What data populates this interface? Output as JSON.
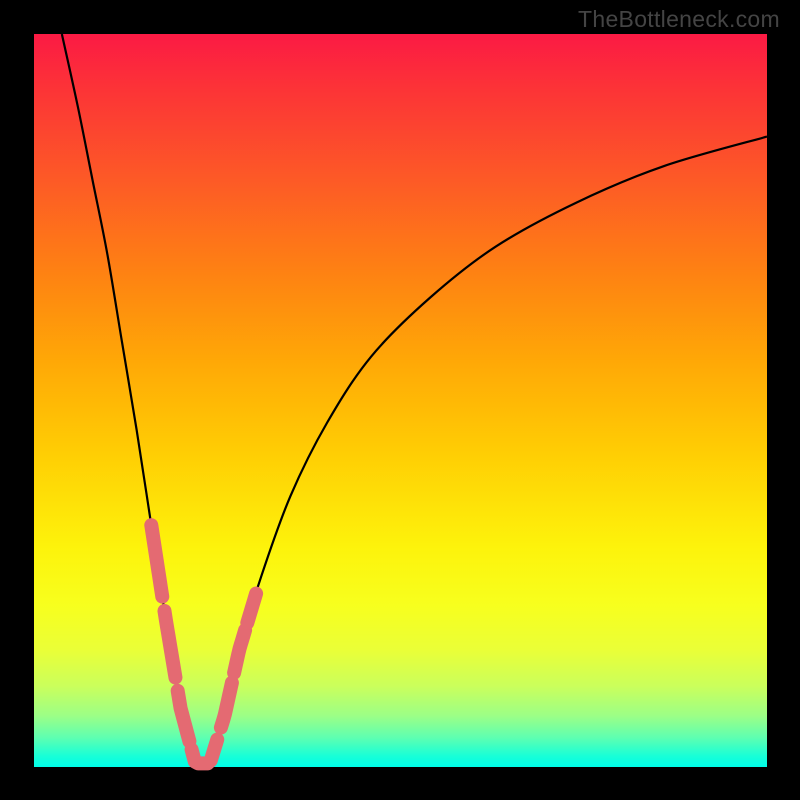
{
  "watermark": "TheBottleneck.com",
  "chart_data": {
    "type": "line",
    "title": "",
    "xlabel": "",
    "ylabel": "",
    "xlim": [
      0,
      100
    ],
    "ylim": [
      0,
      100
    ],
    "grid": false,
    "legend": false,
    "curve_note": "V-shaped performance curve; minimum near x≈22, left arm steep, right arm asymptoting upward",
    "points": [
      {
        "x": 3.8,
        "y": 100
      },
      {
        "x": 6,
        "y": 90
      },
      {
        "x": 8,
        "y": 80
      },
      {
        "x": 10,
        "y": 70
      },
      {
        "x": 12,
        "y": 58
      },
      {
        "x": 14,
        "y": 46
      },
      {
        "x": 16,
        "y": 33
      },
      {
        "x": 18,
        "y": 20
      },
      {
        "x": 20,
        "y": 8
      },
      {
        "x": 22,
        "y": 0.5
      },
      {
        "x": 24,
        "y": 0.5
      },
      {
        "x": 26,
        "y": 7
      },
      {
        "x": 28,
        "y": 16
      },
      {
        "x": 31,
        "y": 26
      },
      {
        "x": 35,
        "y": 37
      },
      {
        "x": 40,
        "y": 47
      },
      {
        "x": 46,
        "y": 56
      },
      {
        "x": 54,
        "y": 64
      },
      {
        "x": 63,
        "y": 71
      },
      {
        "x": 74,
        "y": 77
      },
      {
        "x": 86,
        "y": 82
      },
      {
        "x": 100,
        "y": 86
      }
    ],
    "highlight_segments": [
      {
        "from": 16.0,
        "to": 17.5
      },
      {
        "from": 17.8,
        "to": 19.3
      },
      {
        "from": 19.6,
        "to": 21.2
      },
      {
        "from": 21.5,
        "to": 25.0
      },
      {
        "from": 25.5,
        "to": 27.0
      },
      {
        "from": 27.3,
        "to": 28.8
      },
      {
        "from": 29.1,
        "to": 30.3
      }
    ],
    "highlight_color": "#e46a72",
    "highlight_stroke_width": 14,
    "curve_color": "#000000",
    "curve_stroke_width": 2.2
  }
}
